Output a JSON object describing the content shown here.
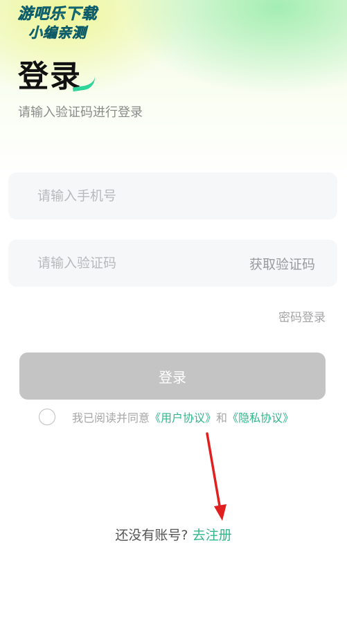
{
  "watermark": {
    "line1": "游吧乐下载",
    "line2": "小编亲测"
  },
  "header": {
    "title": "登录",
    "subtitle": "请输入验证码进行登录"
  },
  "form": {
    "phone_placeholder": "请输入手机号",
    "code_placeholder": "请输入验证码",
    "get_code_label": "获取验证码",
    "password_login_label": "密码登录",
    "login_button_label": "登录"
  },
  "agreement": {
    "prefix": "我已阅读并同意",
    "user_agreement": "《用户协议》",
    "and": "和",
    "privacy_agreement": "《隐私协议》"
  },
  "register": {
    "prompt": "还没有账号?",
    "link_label": "去注册"
  },
  "colors": {
    "accent_green": "#2fb78a",
    "button_disabled": "#c4c4c4",
    "annotation_arrow": "#e01f1f"
  }
}
